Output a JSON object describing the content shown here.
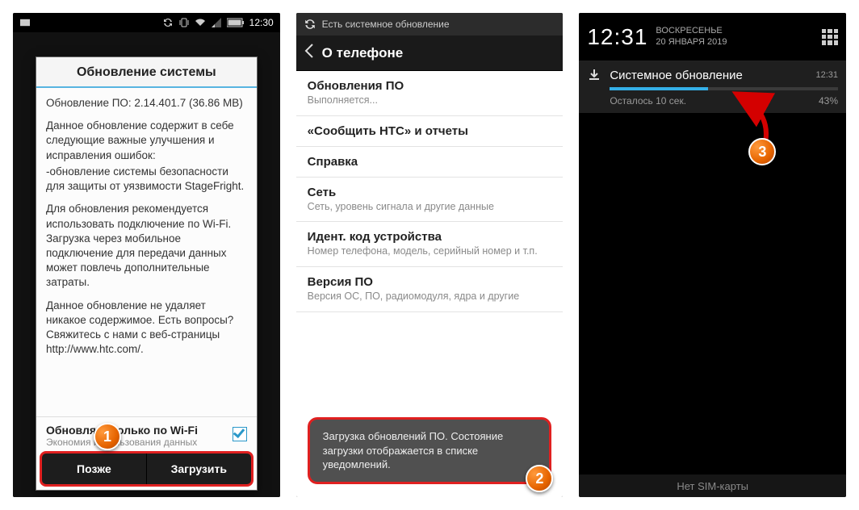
{
  "phone1": {
    "status_time": "12:30",
    "dialog_title": "Обновление системы",
    "line_version": "Обновление ПО: 2.14.401.7 (36.86 MB)",
    "para1": "Данное обновление содержит в себе следующие важные улучшения и исправления ошибок:",
    "para1b": "  -обновление системы безопасности для защиты от уязвимости StageFright.",
    "para2": "Для обновления рекомендуется использовать подключение по Wi-Fi. Загрузка через мобильное подключение для передачи данных может повлечь дополнительные затраты.",
    "para3": "Данное обновление не удаляет никакое содержимое. Есть вопросы? Свяжитесь с нами с веб-страницы http://www.htc.com/.",
    "wifi_label": "Обновлять только по Wi-Fi",
    "wifi_sub": "Экономия использования данных",
    "btn_later": "Позже",
    "btn_download": "Загрузить"
  },
  "phone2": {
    "sync_text": "Есть системное обновление",
    "header_title": "О телефоне",
    "items": [
      {
        "label": "Обновления ПО",
        "sub": "Выполняется..."
      },
      {
        "label": "«Сообщить HTC» и отчеты",
        "sub": ""
      },
      {
        "label": "Справка",
        "sub": ""
      },
      {
        "label": "Сеть",
        "sub": "Сеть, уровень сигнала и другие данные"
      },
      {
        "label": "Идент. код устройства",
        "sub": "Номер телефона, модель, серийный номер и т.п."
      },
      {
        "label": "Версия ПО",
        "sub": "Версия ОС, ПО, радиомодуля, ядра и другие"
      }
    ],
    "toast": "Загрузка обновлений ПО. Состояние загрузки отображается в списке уведомлений."
  },
  "phone3": {
    "clock": "12:31",
    "day": "ВОСКРЕСЕНЬЕ",
    "date": "20 ЯНВАРЯ 2019",
    "notif_title": "Системное обновление",
    "notif_time": "12:31",
    "remaining": "Осталось 10 сек.",
    "percent": "43%",
    "progress_pct": 43,
    "bottom": "Нет SIM-карты"
  },
  "badges": {
    "b1": "1",
    "b2": "2",
    "b3": "3"
  }
}
